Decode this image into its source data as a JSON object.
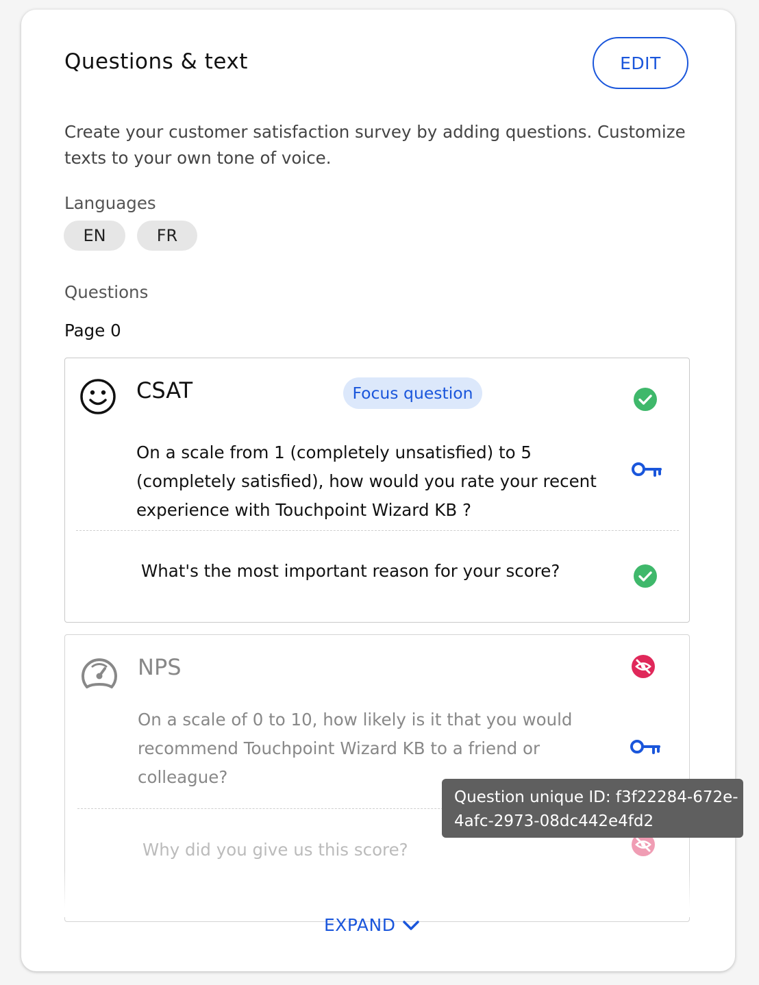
{
  "section": {
    "title": "Questions & text",
    "edit_label": "EDIT",
    "description": "Create your customer satisfaction survey by adding questions. Customize texts to your own tone of voice."
  },
  "languages": {
    "label": "Languages",
    "items": [
      "EN",
      "FR"
    ]
  },
  "questions": {
    "label": "Questions",
    "page_label": "Page 0",
    "csat": {
      "name": "CSAT",
      "badge": "Focus question",
      "text": "On a scale from 1 (completely unsatisfied) to 5 (completely satisfied), how would you rate your recent experience with Touchpoint Wizard KB ?",
      "followup": "What's the most important reason for your score?",
      "icon": "smiley-icon",
      "status": "enabled"
    },
    "nps": {
      "name": "NPS",
      "text": "On a scale of 0 to 10, how likely is it that you would recommend Touchpoint Wizard KB to a friend or colleague?",
      "followup": "Why did you give us this score?",
      "icon": "gauge-icon",
      "status": "disabled"
    }
  },
  "tooltip": {
    "text": "Question unique ID: f3f22284-672e-4afc-2973-08dc442e4fd2"
  },
  "expand_label": "EXPAND",
  "colors": {
    "accent": "#1a56db",
    "success": "#3fb86b",
    "danger": "#e0285a",
    "badge_bg": "#dce8fb"
  }
}
